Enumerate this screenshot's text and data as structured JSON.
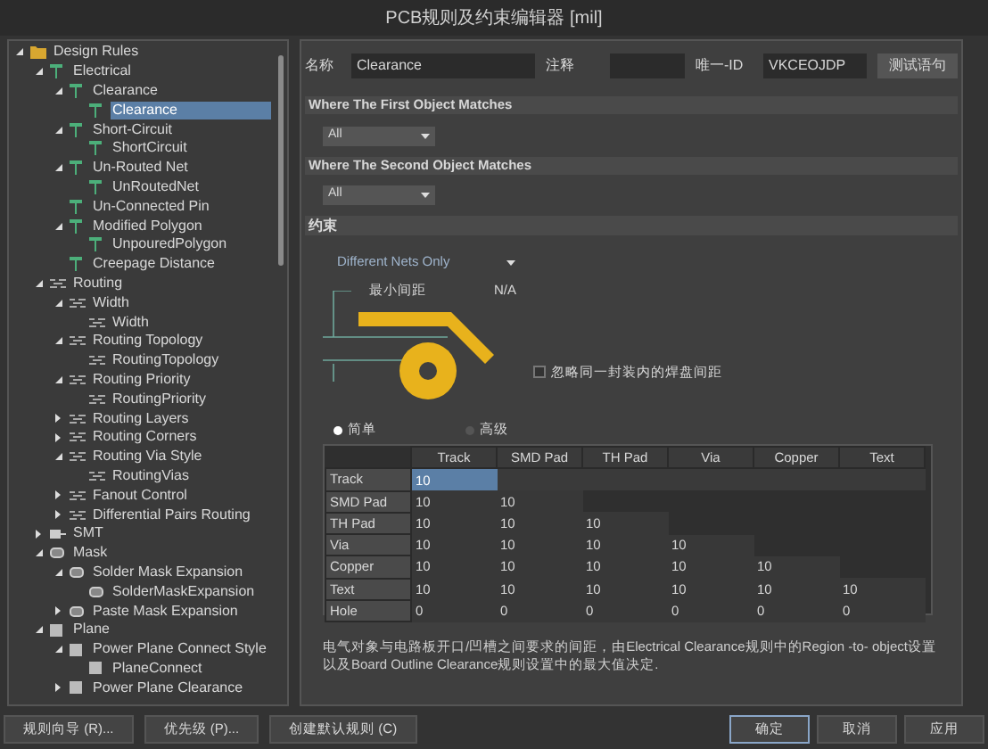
{
  "window": {
    "title": "PCB规则及约束编辑器 [mil]"
  },
  "tree": [
    {
      "label": "Design Rules",
      "kind": "folder",
      "expanded": true,
      "selected": false,
      "children": [
        {
          "label": "Electrical",
          "kind": "electrical",
          "expanded": true,
          "selected": false,
          "children": [
            {
              "label": "Clearance",
              "kind": "electrical",
              "expanded": true,
              "selected": false,
              "children": [
                {
                  "label": "Clearance",
                  "kind": "electrical",
                  "selected": true
                }
              ]
            },
            {
              "label": "Short-Circuit",
              "kind": "electrical",
              "expanded": true,
              "selected": false,
              "children": [
                {
                  "label": "ShortCircuit",
                  "kind": "electrical",
                  "selected": false
                }
              ]
            },
            {
              "label": "Un-Routed Net",
              "kind": "electrical",
              "expanded": true,
              "selected": false,
              "children": [
                {
                  "label": "UnRoutedNet",
                  "kind": "electrical",
                  "selected": false
                }
              ]
            },
            {
              "label": "Un-Connected Pin",
              "kind": "electrical",
              "selected": false
            },
            {
              "label": "Modified Polygon",
              "kind": "electrical",
              "expanded": true,
              "selected": false,
              "children": [
                {
                  "label": "UnpouredPolygon",
                  "kind": "electrical",
                  "selected": false
                }
              ]
            },
            {
              "label": "Creepage Distance",
              "kind": "electrical",
              "selected": false
            }
          ]
        },
        {
          "label": "Routing",
          "kind": "routing",
          "expanded": true,
          "selected": false,
          "children": [
            {
              "label": "Width",
              "kind": "routing",
              "expanded": true,
              "selected": false,
              "children": [
                {
                  "label": "Width",
                  "kind": "routing",
                  "selected": false
                }
              ]
            },
            {
              "label": "Routing Topology",
              "kind": "routing",
              "expanded": true,
              "selected": false,
              "children": [
                {
                  "label": "RoutingTopology",
                  "kind": "routing",
                  "selected": false
                }
              ]
            },
            {
              "label": "Routing Priority",
              "kind": "routing",
              "expanded": true,
              "selected": false,
              "children": [
                {
                  "label": "RoutingPriority",
                  "kind": "routing",
                  "selected": false
                }
              ]
            },
            {
              "label": "Routing Layers",
              "kind": "routing",
              "expanded": false,
              "selected": false
            },
            {
              "label": "Routing Corners",
              "kind": "routing",
              "expanded": false,
              "selected": false
            },
            {
              "label": "Routing Via Style",
              "kind": "routing",
              "expanded": true,
              "selected": false,
              "children": [
                {
                  "label": "RoutingVias",
                  "kind": "routing",
                  "selected": false
                }
              ]
            },
            {
              "label": "Fanout Control",
              "kind": "routing",
              "expanded": false,
              "selected": false
            },
            {
              "label": "Differential Pairs Routing",
              "kind": "routing",
              "expanded": false,
              "selected": false
            }
          ]
        },
        {
          "label": "SMT",
          "kind": "smt",
          "expanded": false,
          "selected": false
        },
        {
          "label": "Mask",
          "kind": "mask",
          "expanded": true,
          "selected": false,
          "children": [
            {
              "label": "Solder Mask Expansion",
              "kind": "mask",
              "expanded": true,
              "selected": false,
              "children": [
                {
                  "label": "SolderMaskExpansion",
                  "kind": "mask",
                  "selected": false
                }
              ]
            },
            {
              "label": "Paste Mask Expansion",
              "kind": "mask",
              "expanded": false,
              "selected": false
            }
          ]
        },
        {
          "label": "Plane",
          "kind": "plane",
          "expanded": true,
          "selected": false,
          "children": [
            {
              "label": "Power Plane Connect Style",
              "kind": "plane",
              "expanded": true,
              "selected": false,
              "children": [
                {
                  "label": "PlaneConnect",
                  "kind": "plane",
                  "selected": false
                }
              ]
            },
            {
              "label": "Power Plane Clearance",
              "kind": "plane",
              "expanded": false,
              "selected": false
            }
          ]
        }
      ]
    }
  ],
  "rule": {
    "name_label": "名称",
    "name": "Clearance",
    "comment_label": "注释",
    "id_label": "唯一-ID",
    "id": "VKCEOJDP",
    "test_button": "测试语句"
  },
  "first_match": {
    "header": "Where The First Object Matches",
    "value": "All"
  },
  "second_match": {
    "header": "Where The Second Object Matches",
    "value": "All"
  },
  "constraints": {
    "header": "约束",
    "net_scope": "Different Nets Only",
    "min_clearance_label": "最小间距",
    "min_clearance_value": "N/A",
    "ignore_pads": {
      "label": "忽略同一封装内的焊盘间距",
      "checked": false
    },
    "modes": [
      {
        "label": "简单",
        "selected": true
      },
      {
        "label": "高级",
        "selected": false
      }
    ]
  },
  "table": {
    "columns": [
      "Track",
      "SMD Pad",
      "TH Pad",
      "Via",
      "Copper",
      "Text"
    ],
    "rows": [
      {
        "header": "Track",
        "cells": [
          {
            "value": "10",
            "selected": true
          }
        ]
      },
      {
        "header": "SMD Pad",
        "cells": [
          {
            "value": "10",
            "selected": false
          },
          {
            "value": "10",
            "selected": false
          }
        ]
      },
      {
        "header": "TH Pad",
        "cells": [
          {
            "value": "10",
            "selected": false
          },
          {
            "value": "10",
            "selected": false
          },
          {
            "value": "10",
            "selected": false
          }
        ]
      },
      {
        "header": "Via",
        "cells": [
          {
            "value": "10",
            "selected": false
          },
          {
            "value": "10",
            "selected": false
          },
          {
            "value": "10",
            "selected": false
          },
          {
            "value": "10",
            "selected": false
          }
        ]
      },
      {
        "header": "Copper",
        "cells": [
          {
            "value": "10",
            "selected": false
          },
          {
            "value": "10",
            "selected": false
          },
          {
            "value": "10",
            "selected": false
          },
          {
            "value": "10",
            "selected": false
          },
          {
            "value": "10",
            "selected": false
          }
        ]
      },
      {
        "header": "Text",
        "cells": [
          {
            "value": "10",
            "selected": false
          },
          {
            "value": "10",
            "selected": false
          },
          {
            "value": "10",
            "selected": false
          },
          {
            "value": "10",
            "selected": false
          },
          {
            "value": "10",
            "selected": false
          },
          {
            "value": "10",
            "selected": false
          }
        ]
      },
      {
        "header": "Hole",
        "cells": [
          {
            "value": "0",
            "selected": false
          },
          {
            "value": "0",
            "selected": false
          },
          {
            "value": "0",
            "selected": false
          },
          {
            "value": "0",
            "selected": false
          },
          {
            "value": "0",
            "selected": false
          },
          {
            "value": "0",
            "selected": false
          }
        ]
      }
    ]
  },
  "note": "电气对象与电路板开口/凹槽之间要求的间距，由Electrical Clearance规则中的Region -to- object设置以及Board Outline Clearance规则设置中的最大值决定.",
  "buttons_left": [
    "规则向导 (R)...",
    "优先级 (P)...",
    "创建默认规则 (C)"
  ],
  "buttons_right": [
    {
      "label": "确定",
      "default": true
    },
    {
      "label": "取消",
      "default": false
    },
    {
      "label": "应用",
      "default": false
    }
  ]
}
